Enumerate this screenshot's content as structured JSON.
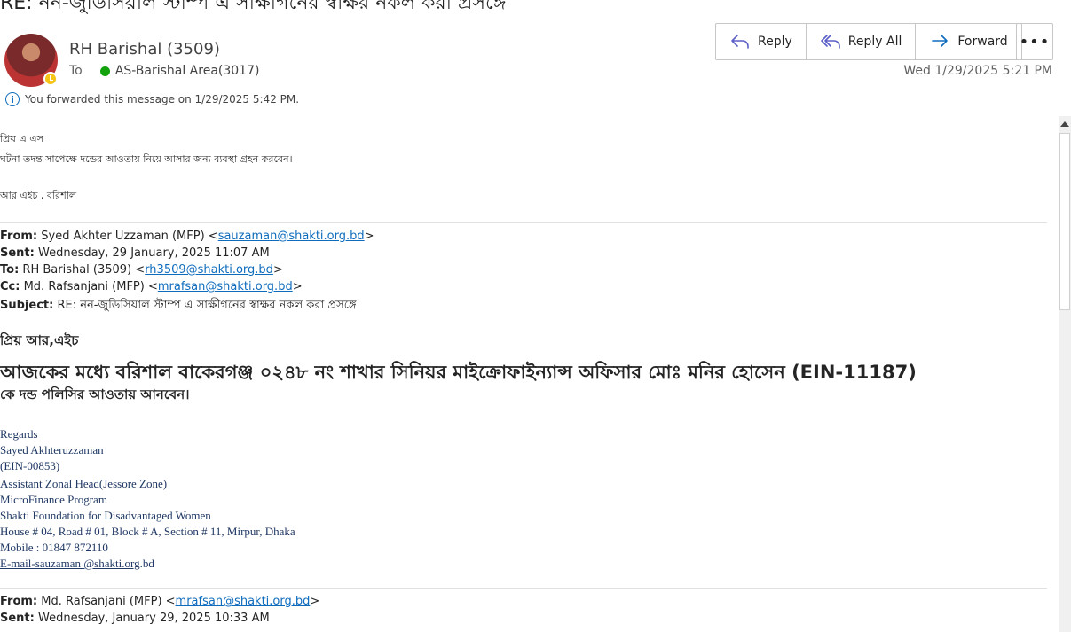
{
  "email": {
    "subject": "RE: নন-জুডিসিয়াল স্টাম্প এ সাক্ষীগনের স্বাক্ষর নকল করা প্রসঙ্গে",
    "sender": "RH Barishal (3509)",
    "to_label": "To",
    "to_name": "AS-Barishal Area(3017)",
    "date": "Wed 1/29/2025 5:21 PM",
    "forward_info": "You forwarded this message on 1/29/2025 5:42 PM."
  },
  "actions": {
    "reply": "Reply",
    "reply_all": "Reply All",
    "forward": "Forward",
    "more": "•••"
  },
  "body": {
    "line1": "প্রিয় এ এস",
    "line2": "ঘটনা তদন্ত সাপেক্ষে দন্ডের আওতায় নিয়ে আসার জন্য ব্যবস্থা গ্রহন করবেন।",
    "line3": "আর এইচ , বরিশাল"
  },
  "quoted1": {
    "from_label": "From:",
    "from_name": "Syed Akhter Uzzaman (MFP) <",
    "from_email": "sauzaman@shakti.org.bd",
    "sent_label": "Sent:",
    "sent": "Wednesday, 29 January, 2025 11:07 AM",
    "to_label": "To:",
    "to_name": "RH Barishal (3509) <",
    "to_email": "rh3509@shakti.org.bd",
    "cc_label": "Cc:",
    "cc_name": "Md. Rafsanjani (MFP) <",
    "cc_email": "mrafsan@shakti.org.bd",
    "subject_label": "Subject:",
    "subject": "RE: নন-জুডিসিয়াল স্টাম্প এ সাক্ষীগনের স্বাক্ষর নকল করা প্রসঙ্গে",
    "close": ">",
    "greeting": "প্রিয় আর,এইচ",
    "main_line": "আজকের মধ্যে বরিশাল বাকেরগঞ্জ ০২৪৮ নং শাখার সিনিয়র মাইক্রোফাইন্যান্স অফিসার  মোঃ মনির হোসেন (EIN-11187)",
    "second_line": "কে দন্ড পলিসির আওতায় আনবেন।"
  },
  "signature": {
    "regards": "Regards",
    "name": "Sayed Akhteruzzaman",
    "ein": "(EIN-00853)",
    "title": "Assistant Zonal Head(Jessore Zone)",
    "program": "MicroFinance Program",
    "org": "Shakti Foundation for Disadvantaged Women",
    "address": "House # 04, Road # 01, Block # A, Section # 11, Mirpur, Dhaka",
    "mobile": "Mobile : 01847 872110",
    "email_link": "E-mail-sauzaman @shakti.org",
    "email_tail": ".bd"
  },
  "quoted2": {
    "from_label": "From:",
    "from_name": "Md. Rafsanjani (MFP) <",
    "from_email": "mrafsan@shakti.org.bd",
    "sent_label": "Sent:",
    "sent": "Wednesday, January 29, 2025 10:33 AM"
  }
}
